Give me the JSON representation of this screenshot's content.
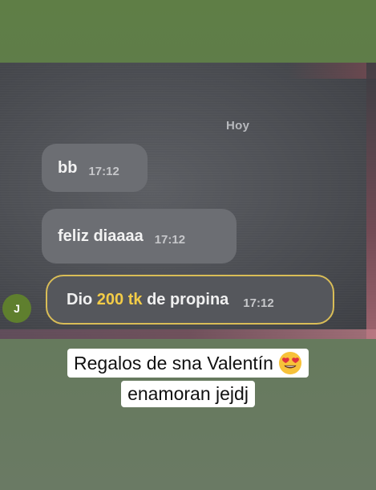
{
  "chat": {
    "date_separator": "Hoy",
    "messages": [
      {
        "text": "bb",
        "time": "17:12"
      },
      {
        "text": "feliz diaaaa",
        "time": "17:12"
      }
    ],
    "tip": {
      "prefix": "Dio",
      "amount": "200 tk",
      "suffix": "de propina",
      "time": "17:12",
      "highlight_color": "#f3cc47"
    },
    "avatar_initial": "J"
  },
  "caption": {
    "line1": "Regalos de sna Valentín",
    "emoji": "heart-eyes-emoji",
    "line2": "enamoran jejdj"
  }
}
